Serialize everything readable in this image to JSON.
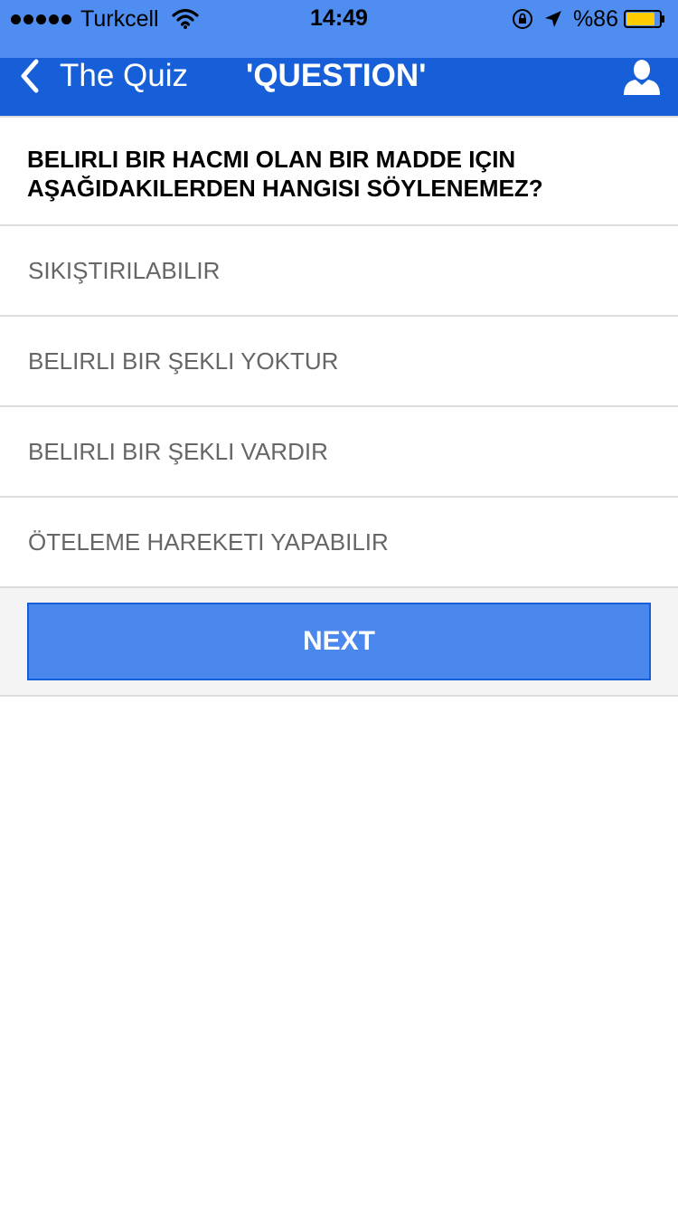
{
  "status_bar": {
    "carrier": "Turkcell",
    "time": "14:49",
    "battery": "%86",
    "battery_level": 0.86,
    "icons": [
      "signal-dots-icon",
      "wifi-icon",
      "rotation-lock-icon",
      "location-arrow-icon",
      "battery-icon"
    ]
  },
  "nav": {
    "back_label": "The Quiz",
    "title": "'QUESTION'",
    "profile_icon": "user-icon"
  },
  "question": {
    "text": "BELIRLI BIR HACMI OLAN BIR MADDE IÇIN AŞAĞIDAKILERDEN HANGISI SÖYLENEMEZ?"
  },
  "answers": [
    {
      "label": "SIKIŞTIRILABILIR"
    },
    {
      "label": "BELIRLI BIR ŞEKLI YOKTUR"
    },
    {
      "label": "BELIRLI BIR ŞEKLI VARDIR"
    },
    {
      "label": "ÖTELEME HAREKETI YAPABILIR"
    }
  ],
  "next_button": {
    "label": "NEXT"
  },
  "colors": {
    "status_bar_bg": "#4f8ef0",
    "nav_bg": "#175fd9",
    "button_bg": "#4a88ee",
    "battery_fill": "#ffcc00"
  }
}
